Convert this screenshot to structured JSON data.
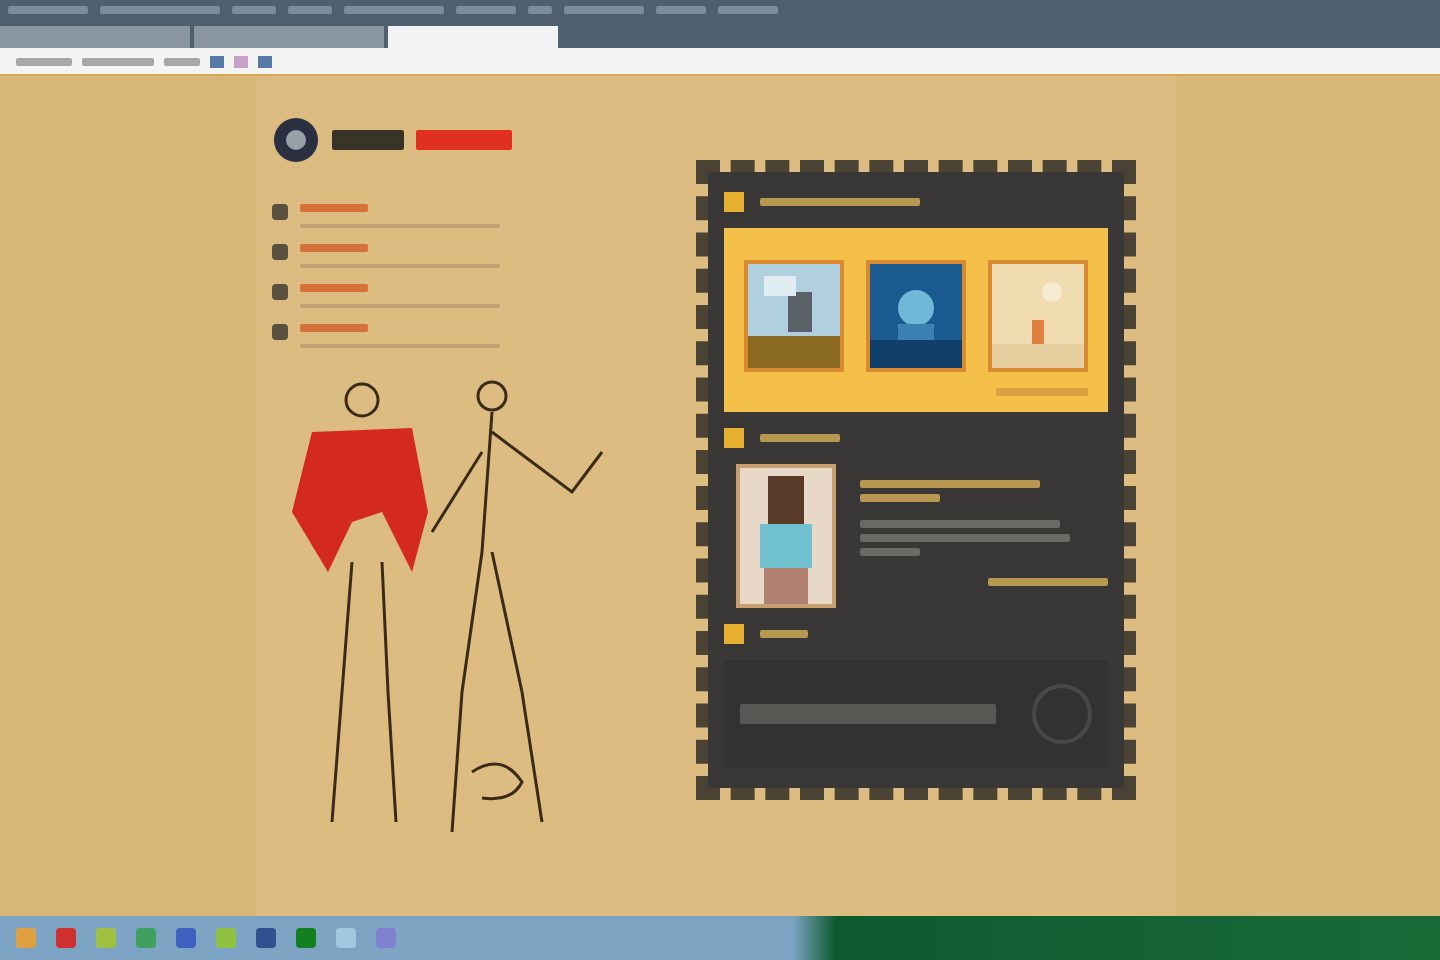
{
  "browser": {
    "tabs": [
      {
        "selected": false
      },
      {
        "selected": false
      },
      {
        "selected": true
      }
    ]
  },
  "nav": {
    "items": [
      {
        "kind": "link"
      },
      {
        "kind": "link"
      },
      {
        "kind": "link"
      },
      {
        "kind": "link"
      }
    ]
  },
  "taskbar": {
    "apps": [
      {
        "color": "#e0a040"
      },
      {
        "color": "#d03030"
      },
      {
        "color": "#a0c040"
      },
      {
        "color": "#40a060"
      },
      {
        "color": "#4060c0"
      },
      {
        "color": "#90c040"
      },
      {
        "color": "#305090"
      },
      {
        "color": "#108020"
      },
      {
        "color": "#a0c8e0"
      },
      {
        "color": "#8080d0"
      }
    ]
  }
}
